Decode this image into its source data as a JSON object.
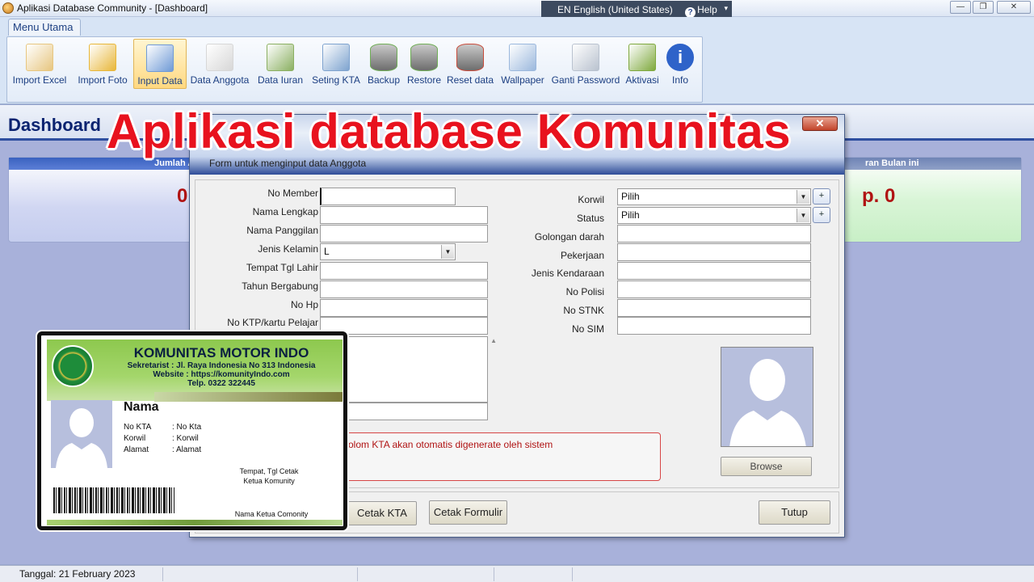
{
  "window": {
    "title": "Aplikasi Database Community - [Dashboard]",
    "language": "EN English (United States)",
    "help_label": "Help",
    "controls": {
      "minimize": "—",
      "restore": "❐",
      "close": "✕"
    }
  },
  "ribbon": {
    "tab": "Menu Utama",
    "buttons": [
      {
        "label": "Import Excel",
        "icon": "spreadsheet-icon",
        "color": "#e7c680"
      },
      {
        "label": "Import Foto",
        "icon": "folder-image-icon",
        "color": "#e8b73a"
      },
      {
        "label": "Input Data",
        "icon": "form-edit-icon",
        "color": "#6f9ad6"
      },
      {
        "label": "Data Anggota",
        "icon": "signature-icon",
        "color": "#d7d7d7"
      },
      {
        "label": "Data Iuran",
        "icon": "money-chart-icon",
        "color": "#8bb062"
      },
      {
        "label": "Seting KTA",
        "icon": "id-card-icon",
        "color": "#7ea3cf"
      },
      {
        "label": "Backup",
        "icon": "database-backup-icon",
        "color": "#6fae55"
      },
      {
        "label": "Restore",
        "icon": "database-restore-icon",
        "color": "#6fae55"
      },
      {
        "label": "Reset data",
        "icon": "database-reset-icon",
        "color": "#c94b3b"
      },
      {
        "label": "Wallpaper",
        "icon": "wallpaper-icon",
        "color": "#9bb8dd"
      },
      {
        "label": "Ganti Password",
        "icon": "lock-icon",
        "color": "#b9c2cf"
      },
      {
        "label": "Aktivasi",
        "icon": "key-icon",
        "color": "#7fa93e"
      },
      {
        "label": "Info",
        "icon": "info-icon",
        "color": "#2e63c9"
      }
    ],
    "active": "Input Data"
  },
  "dashboard": {
    "title": "Dashboard",
    "cards": [
      {
        "header": "Jumlah An",
        "value": "0"
      },
      {
        "header": "ran Bulan ini",
        "value": "p. 0"
      }
    ]
  },
  "headline": "Aplikasi database Komunitas",
  "form": {
    "close_label": "✕",
    "subtitle": "Form untuk menginput data Anggota",
    "left_labels": {
      "no_member": "No Member",
      "nama_lengkap": "Nama Lengkap",
      "nama_panggilan": "Nama Panggilan",
      "jenis_kelamin": "Jenis Kelamin",
      "tempat_tgl_lahir": "Tempat Tgl Lahir",
      "tahun_bergabung": "Tahun Bergabung",
      "no_hp": "No Hp",
      "no_ktp": "No KTP/kartu Pelajar"
    },
    "jenis_kelamin_value": "L",
    "right_labels": {
      "korwil": "Korwil",
      "status": "Status",
      "golongan_darah": "Golongan darah",
      "pekerjaan": "Pekerjaan",
      "jenis_kendaraan": "Jenis Kendaraan",
      "no_polisi": "No Polisi",
      "no_stnk": "No STNK",
      "no_sim": "No SIM"
    },
    "korwil_value": "Pilih",
    "status_value": "Pilih",
    "plus_label": "+",
    "notice": "olom KTA akan otomatis digenerate oleh sistem",
    "browse_label": "Browse",
    "cetak_kta_label": "Cetak KTA",
    "cetak_formulir_label": "Cetak Formulir",
    "tutup_label": "Tutup"
  },
  "member_card": {
    "org_name": "KOMUNITAS MOTOR INDO",
    "address_line1": "Sekretarist : Jl. Raya Indonesia No 313 Indonesia",
    "address_line2": "Website : https://komunityIndo.com",
    "address_line3": "Telp. 0322 322445",
    "name": "Nama",
    "rows": [
      {
        "key": "No KTA",
        "value": ": No Kta"
      },
      {
        "key": "Korwil",
        "value": ": Korwil"
      },
      {
        "key": "Alamat",
        "value": ": Alamat"
      }
    ],
    "sign_place": "Tempat, Tgl Cetak",
    "sign_title": "Ketua Komunity",
    "sign_name": "Nama Ketua Comonity"
  },
  "statusbar": {
    "date": "Tanggal:  21 February 2023"
  }
}
